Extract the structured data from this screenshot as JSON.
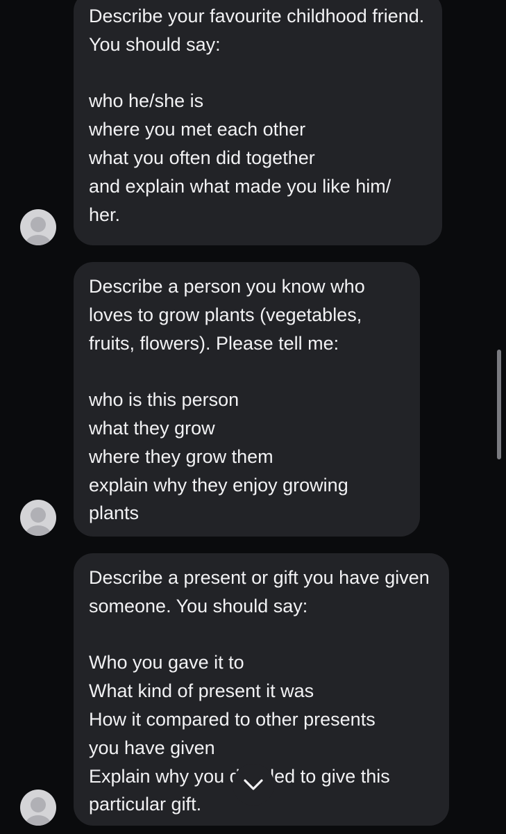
{
  "messages": [
    {
      "text": "Describe your favourite childhood friend. You should say:\n\nwho he/she is\nwhere you met each other\nwhat you often did together\nand explain what made you like him/\nher."
    },
    {
      "text": "Describe a person you know who loves to grow plants (vegetables, fruits, flowers). Please tell me:\n\nwho is this person\nwhat they grow\nwhere they grow them\nexplain why they enjoy growing\nplants"
    },
    {
      "text": "Describe a present or gift you have given someone. You should say:\n\nWho you gave it to\nWhat kind of present it was\nHow it compared to other presents\nyou have given\nExplain why you decided to give this\nparticular gift."
    }
  ],
  "icons": {
    "avatar": "default-user-avatar-icon",
    "scroll_down": "chevron-down-icon"
  },
  "colors": {
    "background": "#0a0b0d",
    "bubble": "#222327",
    "text": "#f2f2f4",
    "avatar": "#d4d4d7"
  }
}
